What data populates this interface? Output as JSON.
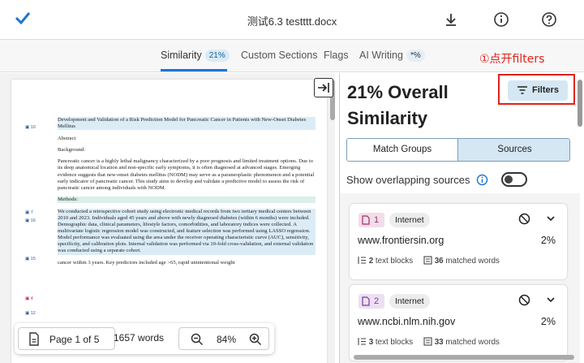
{
  "header": {
    "title": "测试6.3 testttt.docx",
    "icons": [
      "check-icon",
      "download-icon",
      "info-icon",
      "help-icon"
    ]
  },
  "tabs": [
    {
      "label": "Similarity",
      "badge": "21%",
      "active": true
    },
    {
      "label": "Custom Sections"
    },
    {
      "label": "Flags"
    },
    {
      "label": "AI Writing",
      "badge": "*%"
    }
  ],
  "annotation": "①点开filters",
  "document": {
    "markers": [
      "10",
      "7",
      "16",
      "15",
      "4",
      "12"
    ],
    "title": "Development and Validation of a Risk Prediction Model for Pancreatic Cancer in Patients with New-Onset Diabetes Mellitus",
    "abstract_heading": "Abstract",
    "background_heading": "Background:",
    "background_text": "Pancreatic cancer is a highly lethal malignancy characterized by a poor prognosis and limited treatment options. Due to its deep anatomical location and non-specific early symptoms, it is often diagnosed at advanced stages. Emerging evidence suggests that new-onset diabetes mellitus (NODM) may serve as a paraneoplastic phenomenon and a potential early indicator of pancreatic cancer. This study aims to develop and validate a predictive model to assess the risk of pancreatic cancer among individuals with NODM.",
    "methods_heading": "Methods:",
    "methods_text": "We conducted a retrospective cohort study using electronic medical records from two tertiary medical centers between 2010 and 2023. Individuals aged 45 years and above with newly diagnosed diabetes (within 6 months) were included. Demographic data, clinical parameters, lifestyle factors, comorbidities, and laboratory indices were collected. A multivariate logistic regression model was constructed, and feature selection was performed using LASSO regression. Model performance was evaluated using the area under the receiver operating characteristic curve (AUC), sensitivity, specificity, and calibration plots. Internal validation was performed via 10-fold cross-validation, and external validation was conducted using a separate cohort.",
    "trailing_text": "cancer within 3 years. Key predictors included age >65, rapid unintentional weight"
  },
  "footer": {
    "page_label": "Page 1 of 5",
    "words_label": "1657 words",
    "zoom_label": "84%"
  },
  "panel": {
    "title": "21% Overall Similarity",
    "filters_label": "Filters",
    "seg_left": "Match Groups",
    "seg_right": "Sources",
    "overlap_label": "Show overlapping sources"
  },
  "sources": [
    {
      "number": "1",
      "type": "Internet",
      "host": "www.frontiersin.org",
      "percent": "2%",
      "text_blocks": "2",
      "text_blocks_label": "text blocks",
      "matched_words": "36",
      "matched_words_label": "matched words"
    },
    {
      "number": "2",
      "type": "Internet",
      "host": "www.ncbi.nlm.nih.gov",
      "percent": "2%",
      "text_blocks": "3",
      "text_blocks_label": "text blocks",
      "matched_words": "33",
      "matched_words_label": "matched words"
    }
  ],
  "colors": {
    "accent": "#1b76d3",
    "annotation": "#e0211b",
    "selected": "#d5e7f3"
  }
}
